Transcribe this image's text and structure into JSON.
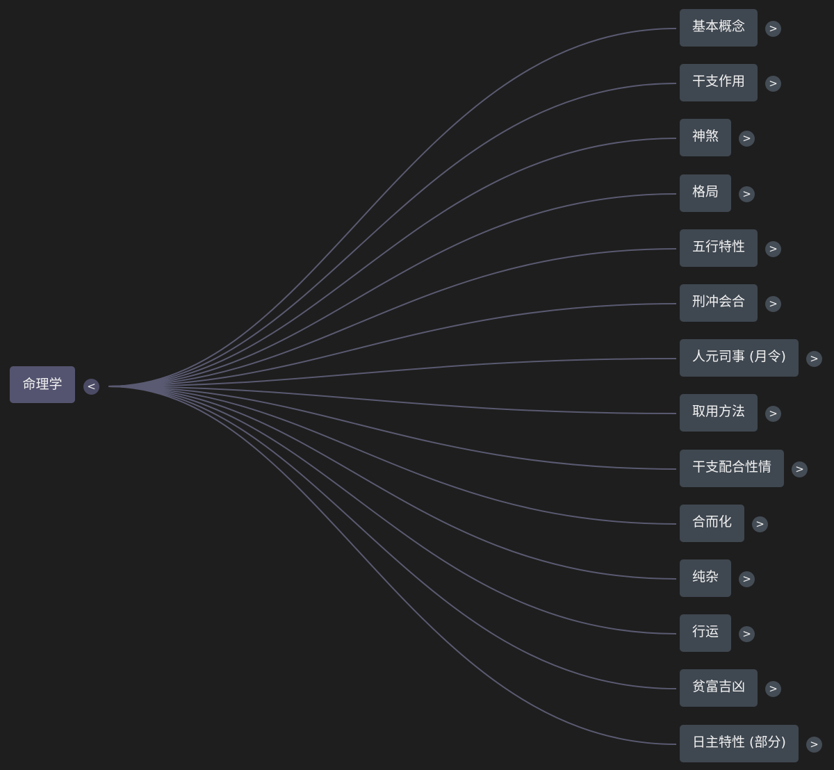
{
  "root": {
    "label": "命理学",
    "toggle": "<"
  },
  "children": [
    {
      "label": "基本概念",
      "toggle": ">"
    },
    {
      "label": "干支作用",
      "toggle": ">"
    },
    {
      "label": "神煞",
      "toggle": ">"
    },
    {
      "label": "格局",
      "toggle": ">"
    },
    {
      "label": "五行特性",
      "toggle": ">"
    },
    {
      "label": "刑冲会合",
      "toggle": ">"
    },
    {
      "label": "人元司事 (月令)",
      "toggle": ">"
    },
    {
      "label": "取用方法",
      "toggle": ">"
    },
    {
      "label": "干支配合性情",
      "toggle": ">"
    },
    {
      "label": "合而化",
      "toggle": ">"
    },
    {
      "label": "纯杂",
      "toggle": ">"
    },
    {
      "label": "行运",
      "toggle": ">"
    },
    {
      "label": "贫富吉凶",
      "toggle": ">"
    },
    {
      "label": "日主特性 (部分)",
      "toggle": ">"
    }
  ],
  "colors": {
    "background": "#1e1e1e",
    "root_node": "#545470",
    "child_node": "#3f4750",
    "connector": "#5a5a72",
    "text": "#f2f2f2"
  }
}
